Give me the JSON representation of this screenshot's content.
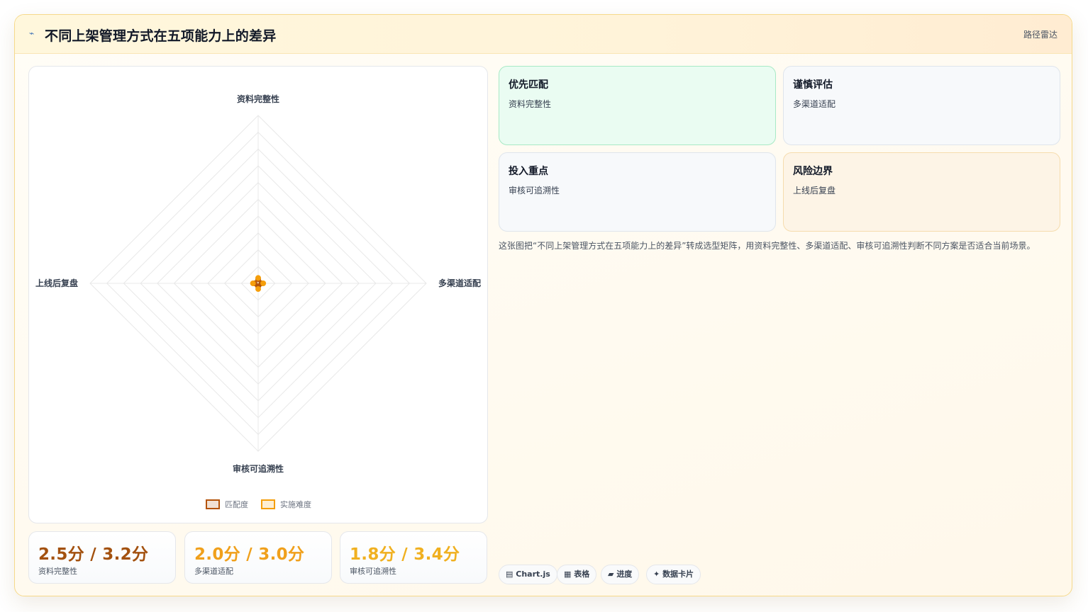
{
  "header": {
    "icon": "chart-line-icon",
    "title": "不同上架管理方式在五项能力上的差异",
    "tag": "路径雷达"
  },
  "chart_data": {
    "type": "radar",
    "axes": [
      "资料完整性",
      "多渠道适配",
      "审核可追溯性",
      "上线后复盘"
    ],
    "series": [
      {
        "name": "匹配度",
        "values": [
          2.5,
          2.0,
          1.8,
          2.2
        ],
        "color": "#b45309"
      },
      {
        "name": "实施难度",
        "values": [
          3.2,
          3.0,
          3.4,
          3.1
        ],
        "color": "#f59e0b"
      }
    ],
    "rmax": 100,
    "rings": 10,
    "grid": true,
    "legend": "bottom"
  },
  "stats": [
    {
      "value": "2.5分 / 3.2分",
      "label": "资料完整性",
      "color": "#a3510f"
    },
    {
      "value": "2.0分 / 3.0分",
      "label": "多渠道适配",
      "color": "#f0a01c"
    },
    {
      "value": "1.8分 / 3.4分",
      "label": "审核可追溯性",
      "color": "#f0b020"
    }
  ],
  "matrix": [
    {
      "title": "优先匹配",
      "sub": "资料完整性",
      "bg": "#eafcf2",
      "border": "#a7e9c5"
    },
    {
      "title": "谨慎评估",
      "sub": "多渠道适配",
      "bg": "#f7f9fb",
      "border": "#dfe5ec"
    },
    {
      "title": "投入重点",
      "sub": "审核可追溯性",
      "bg": "#f7f9fb",
      "border": "#dfe5ec"
    },
    {
      "title": "风险边界",
      "sub": "上线后复盘",
      "bg": "#fdf4e6",
      "border": "#f6dcae"
    }
  ],
  "description": "这张图把“不同上架管理方式在五项能力上的差异”转成选型矩阵，用资料完整性、多渠道适配、审核可追溯性判断不同方案是否适合当前场景。",
  "chips": [
    {
      "icon": "chart-icon",
      "glyph": "▤",
      "label": "Chart.js"
    },
    {
      "icon": "table-icon",
      "glyph": "▦",
      "label": "表格"
    },
    {
      "icon": "progress-icon",
      "glyph": "▰",
      "label": "进度"
    },
    {
      "icon": "spark-icon",
      "glyph": "✦",
      "label": "数据卡片"
    }
  ]
}
